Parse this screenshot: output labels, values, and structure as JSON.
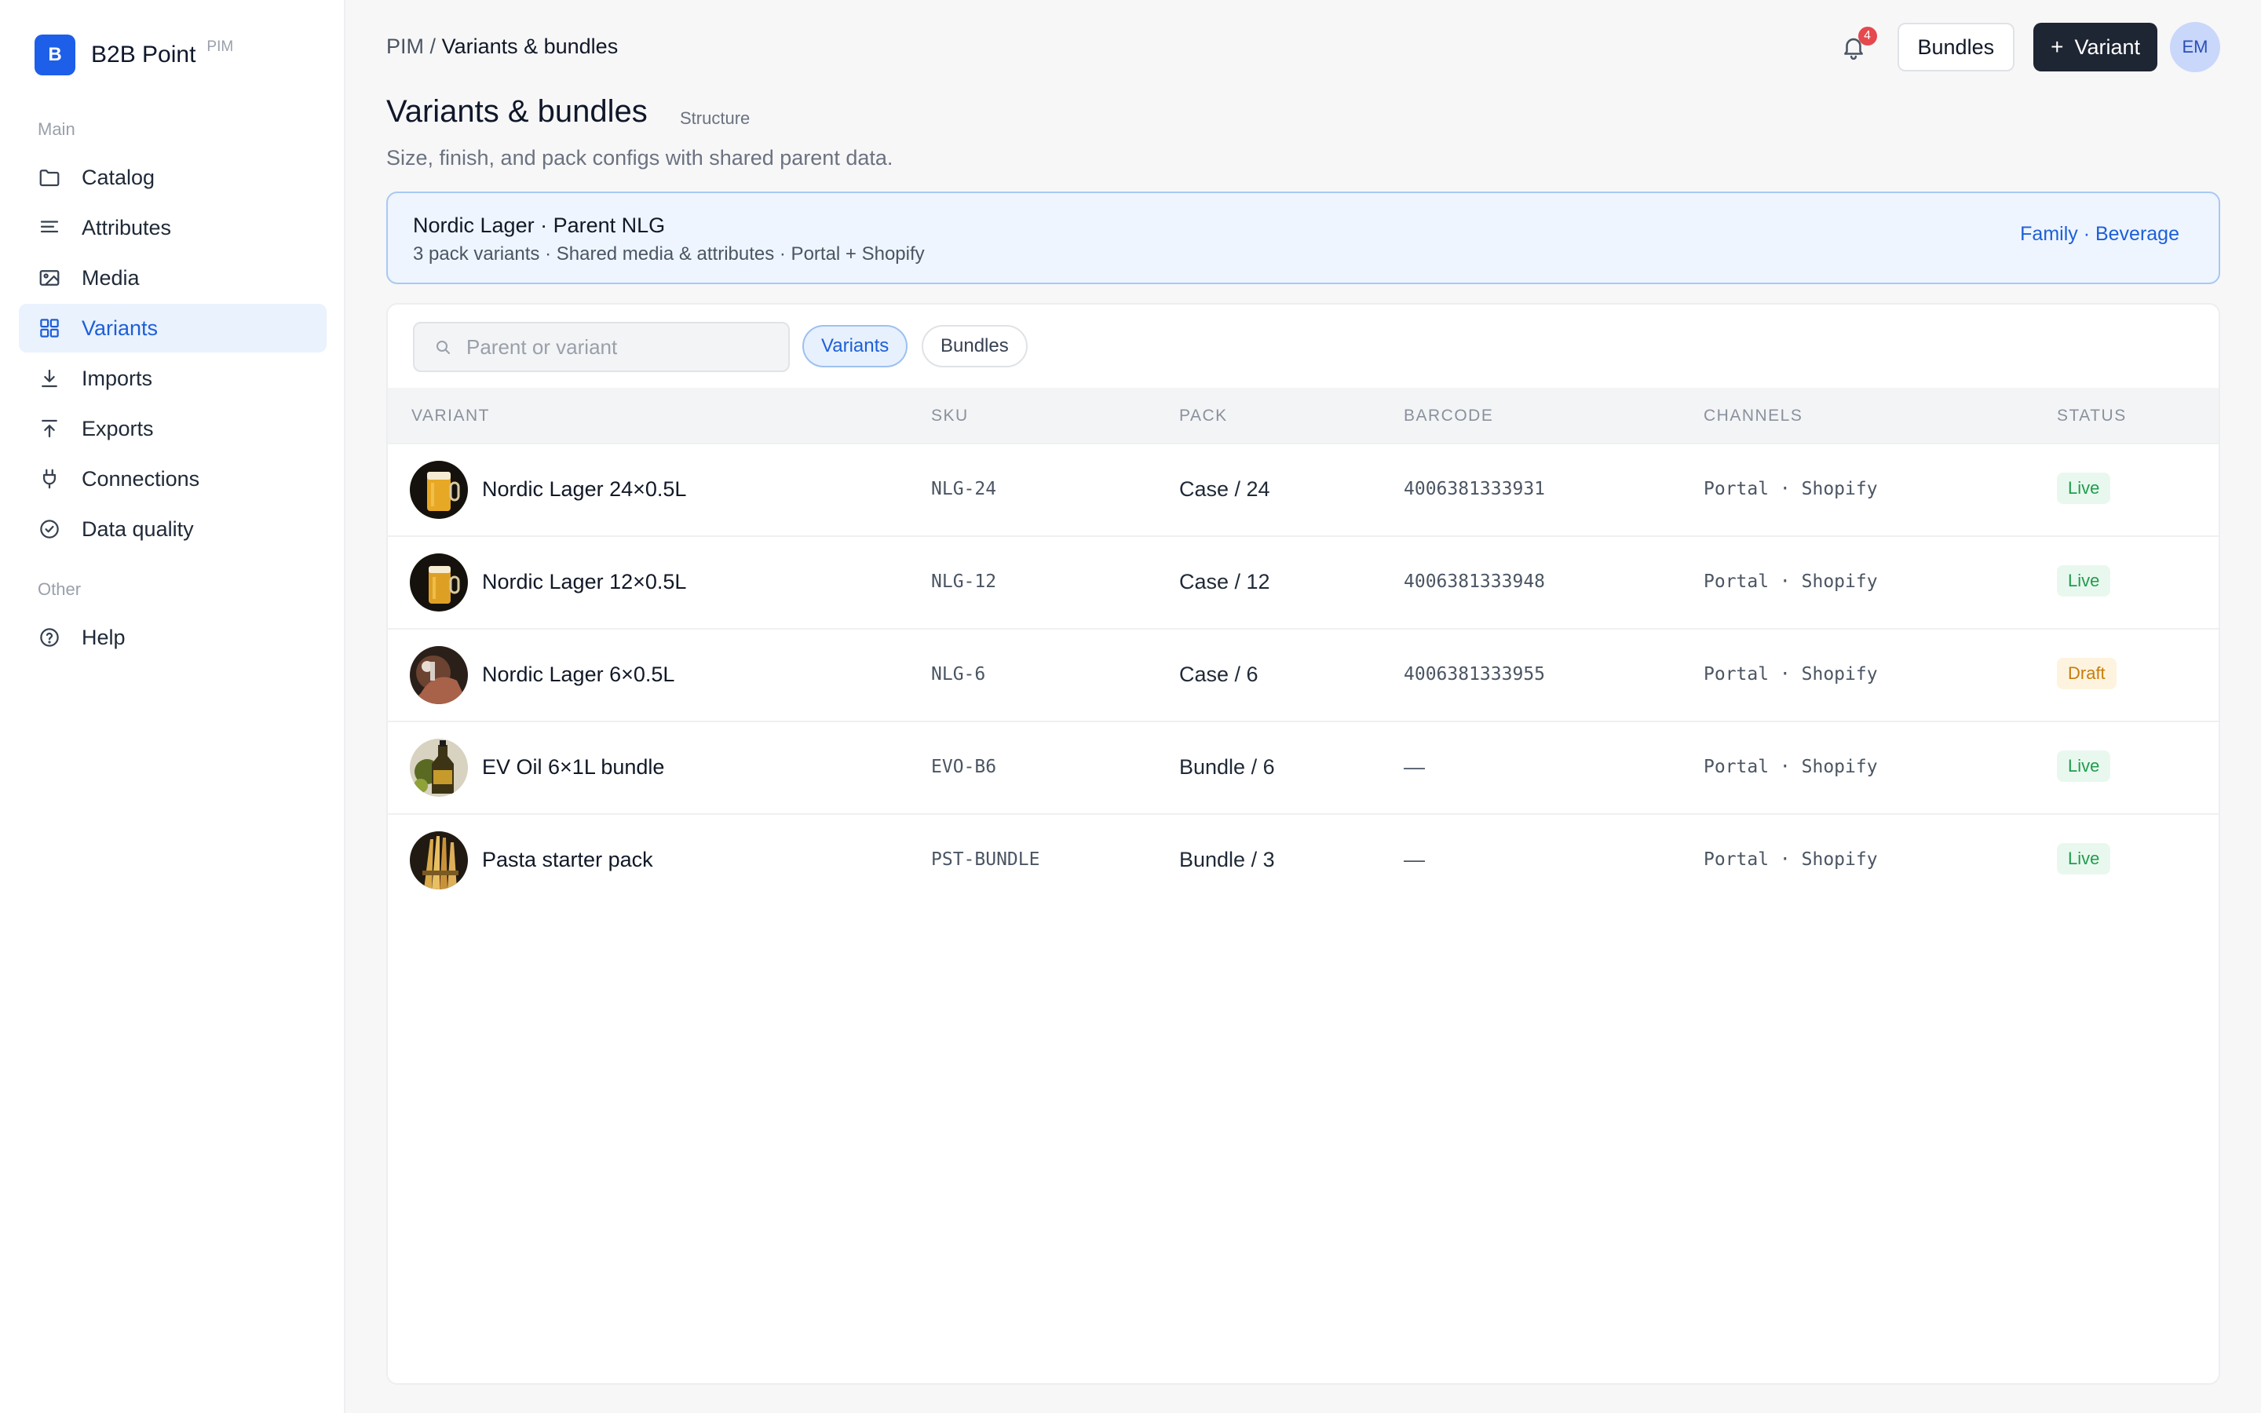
{
  "brand": {
    "logo_letter": "B",
    "name": "B2B Point",
    "tag": "PIM"
  },
  "sidebar": {
    "section_main": "Main",
    "section_other": "Other",
    "items": [
      {
        "label": "Catalog",
        "icon": "folder-icon"
      },
      {
        "label": "Attributes",
        "icon": "list-icon"
      },
      {
        "label": "Media",
        "icon": "image-icon"
      },
      {
        "label": "Variants",
        "icon": "grid-icon",
        "active": true
      },
      {
        "label": "Imports",
        "icon": "download-icon"
      },
      {
        "label": "Exports",
        "icon": "upload-icon"
      },
      {
        "label": "Connections",
        "icon": "plug-icon"
      },
      {
        "label": "Data quality",
        "icon": "check-circle-icon"
      }
    ],
    "other_items": [
      {
        "label": "Help",
        "icon": "help-circle-icon"
      }
    ]
  },
  "header": {
    "breadcrumb_root": "PIM",
    "breadcrumb_sep": "/",
    "breadcrumb_current": "Variants & bundles",
    "notification_count": "4",
    "bundles_button": "Bundles",
    "variant_button_plus": "+",
    "variant_button": "Variant",
    "avatar_initials": "EM"
  },
  "page": {
    "title": "Variants & bundles",
    "tag": "Structure",
    "subtitle": "Size, finish, and pack configs with shared parent data."
  },
  "parent": {
    "title": "Nordic Lager · Parent NLG",
    "meta": "3 pack variants · Shared media & attributes · Portal + Shopify",
    "family": "Family · Beverage"
  },
  "filters": {
    "search_placeholder": "Parent or variant",
    "chips": [
      "Variants",
      "Bundles"
    ],
    "active_chip": "Variants"
  },
  "table": {
    "columns": [
      "VARIANT",
      "SKU",
      "PACK",
      "BARCODE",
      "CHANNELS",
      "STATUS"
    ],
    "rows": [
      {
        "name": "Nordic Lager 24×0.5L",
        "sku": "NLG-24",
        "pack": "Case / 24",
        "barcode": "4006381333931",
        "channels": "Portal · Shopify",
        "status": "Live"
      },
      {
        "name": "Nordic Lager 12×0.5L",
        "sku": "NLG-12",
        "pack": "Case / 12",
        "barcode": "4006381333948",
        "channels": "Portal · Shopify",
        "status": "Live"
      },
      {
        "name": "Nordic Lager 6×0.5L",
        "sku": "NLG-6",
        "pack": "Case / 6",
        "barcode": "4006381333955",
        "channels": "Portal · Shopify",
        "status": "Draft"
      },
      {
        "name": "EV Oil 6×1L bundle",
        "sku": "EVO-B6",
        "pack": "Bundle / 6",
        "barcode": "—",
        "channels": "Portal · Shopify",
        "status": "Live"
      },
      {
        "name": "Pasta starter pack",
        "sku": "PST-BUNDLE",
        "pack": "Bundle / 3",
        "barcode": "—",
        "channels": "Portal · Shopify",
        "status": "Live"
      }
    ]
  },
  "colors": {
    "accent": "#1d5fd8",
    "brand": "#1d5fe8",
    "live": "#1f9d4d",
    "draft": "#c77d0a",
    "badge": "#e5484d"
  }
}
